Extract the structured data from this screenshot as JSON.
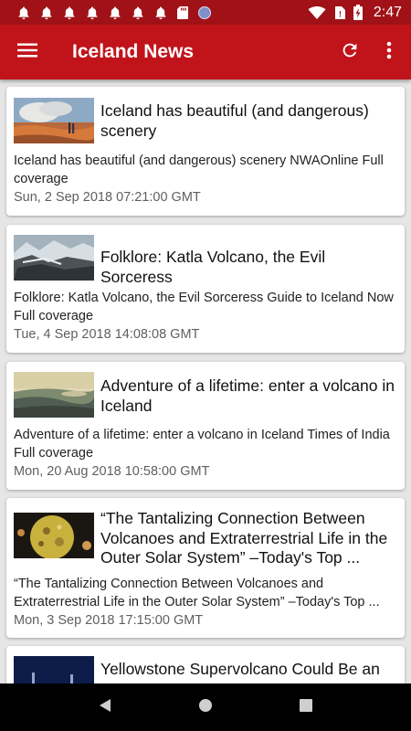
{
  "status_bar": {
    "time": "2:47",
    "notification_icons": [
      "bell-icon",
      "bell-icon",
      "bell-icon",
      "bell-icon",
      "bell-icon",
      "bell-icon",
      "bell-icon",
      "sd-card-icon",
      "circle-icon"
    ],
    "system_icons": [
      "wifi-icon",
      "no-sim-icon",
      "battery-charging-icon"
    ]
  },
  "app_bar": {
    "title": "Iceland News",
    "icons": [
      "menu-icon",
      "refresh-icon",
      "more-vert-icon"
    ]
  },
  "articles": [
    {
      "title": "Iceland has beautiful (and dangerous) scenery",
      "description": "Iceland has beautiful (and dangerous) scenery  NWAOnline  Full coverage",
      "date": "Sun, 2 Sep 2018 07:21:00 GMT"
    },
    {
      "title": "Folklore: Katla Volcano, the Evil Sorceress",
      "description": "Folklore: Katla Volcano, the Evil Sorceress  Guide to Iceland Now  Full coverage",
      "date": "Tue, 4 Sep 2018 14:08:08 GMT"
    },
    {
      "title": "Adventure of a lifetime: enter a volcano in Iceland",
      "description": "Adventure of a lifetime: enter a volcano in Iceland  Times of India  Full coverage",
      "date": "Mon, 20 Aug 2018 10:58:00 GMT"
    },
    {
      "title": "“The Tantalizing Connection Between Volcanoes and Extraterrestrial Life in the Outer Solar System” –Today's Top ...",
      "description": "“The Tantalizing Connection Between Volcanoes and Extraterrestrial Life in the Outer Solar System” –Today's Top ...",
      "date": "Mon, 3 Sep 2018 17:15:00 GMT"
    },
    {
      "title": "Yellowstone Supervolcano Could Be an",
      "description": "",
      "date": ""
    }
  ],
  "nav_bar": {
    "icons": [
      "back-icon",
      "home-icon",
      "recents-icon"
    ]
  }
}
